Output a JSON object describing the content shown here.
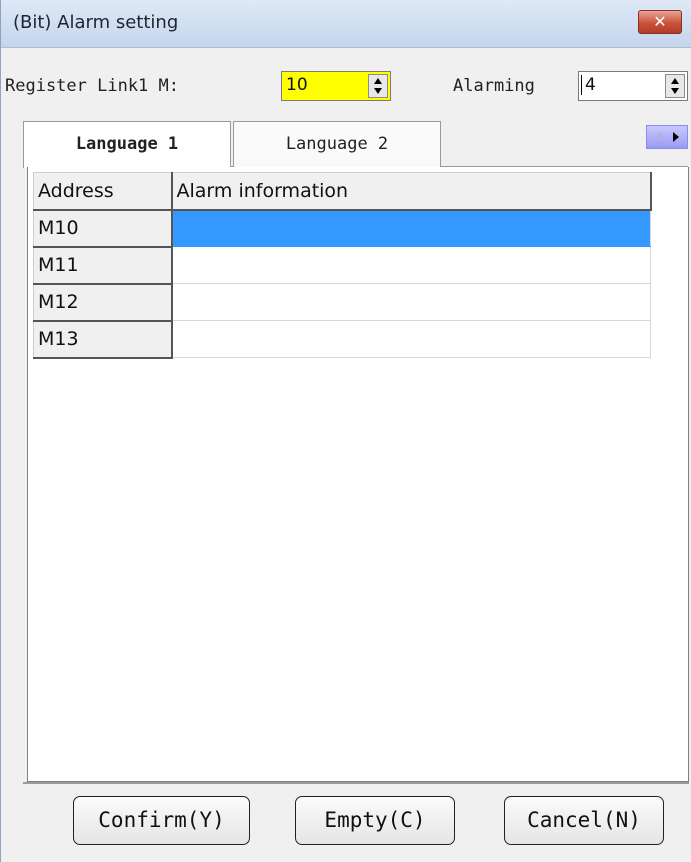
{
  "window": {
    "title": "(Bit) Alarm setting"
  },
  "register": {
    "label": "Register Link1 M:",
    "value": "10",
    "highlight_color": "#ffff00"
  },
  "alarming": {
    "label": "Alarming",
    "value": "4"
  },
  "tabs": [
    {
      "label": "Language 1",
      "active": true
    },
    {
      "label": "Language 2",
      "active": false
    }
  ],
  "table": {
    "columns": [
      "Address",
      "Alarm information"
    ],
    "rows": [
      {
        "address": "M10",
        "info": "",
        "selected": true
      },
      {
        "address": "M11",
        "info": ""
      },
      {
        "address": "M12",
        "info": ""
      },
      {
        "address": "M13",
        "info": ""
      }
    ],
    "selection_color": "#3399ff"
  },
  "buttons": {
    "confirm": "Confirm(Y)",
    "empty": "Empty(C)",
    "cancel": "Cancel(N)"
  }
}
